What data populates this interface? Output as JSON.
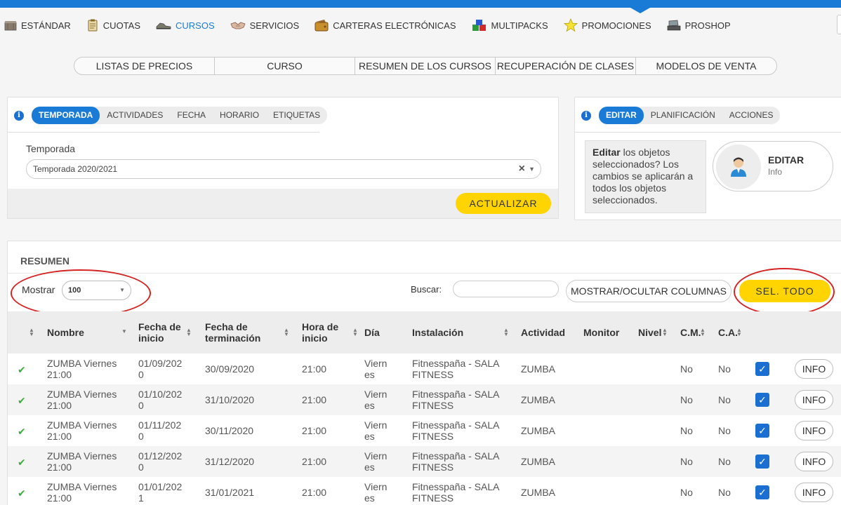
{
  "nav": {
    "items": [
      {
        "label": "ESTÁNDAR",
        "icon": "box-icon",
        "active": false
      },
      {
        "label": "CUOTAS",
        "icon": "clipboard-icon",
        "active": false
      },
      {
        "label": "CURSOS",
        "icon": "shoe-icon",
        "active": true
      },
      {
        "label": "SERVICIOS",
        "icon": "handshake-icon",
        "active": false
      },
      {
        "label": "CARTERAS ELECTRÓNICAS",
        "icon": "wallet-icon",
        "active": false
      },
      {
        "label": "MULTIPACKS",
        "icon": "cubes-icon",
        "active": false
      },
      {
        "label": "PROMOCIONES",
        "icon": "star-icon",
        "active": false
      },
      {
        "label": "PROSHOP",
        "icon": "register-icon",
        "active": false
      }
    ]
  },
  "subtabs": [
    "LISTAS DE PRECIOS",
    "CURSO",
    "RESUMEN DE LOS CURSOS",
    "RECUPERACIÓN DE CLASES",
    "MODELOS DE VENTA"
  ],
  "filter": {
    "tabs": [
      "TEMPORADA",
      "ACTIVIDADES",
      "FECHA",
      "HORARIO",
      "ETIQUETAS"
    ],
    "field_label": "Temporada",
    "selected": "Temporada 2020/2021",
    "update_label": "ACTUALIZAR"
  },
  "actions": {
    "tabs": [
      "EDITAR",
      "PLANIFICACIÓN",
      "ACCIONES"
    ],
    "desc_bold": "Editar",
    "desc_rest": " los objetos seleccionados? Los cambios se aplicarán a todos los objetos seleccionados.",
    "card_title": "EDITAR",
    "card_sub": "Info"
  },
  "summary": {
    "title": "RESUMEN",
    "show_label": "Mostrar",
    "show_value": "100",
    "search_label": "Buscar:",
    "columns_button": "MOSTRAR/OCULTAR COLUMNAS",
    "select_all": "SEL. TODO",
    "headers": [
      "Nombre",
      "Fecha de inicio",
      "Fecha de terminación",
      "Hora de inicio",
      "Día",
      "Instalación",
      "Actividad",
      "Monitor",
      "Nivel",
      "C.M.",
      "C.A."
    ],
    "rows": [
      {
        "nombre": "ZUMBA Viernes 21:00",
        "inicio": "01/09/2020",
        "fin": "30/09/2020",
        "hora": "21:00",
        "dia": "Viernes",
        "inst": "Fitnesspaña - SALA FITNESS",
        "act": "ZUMBA",
        "cm": "No",
        "ca": "No",
        "info": "INFO"
      },
      {
        "nombre": "ZUMBA Viernes 21:00",
        "inicio": "01/10/2020",
        "fin": "31/10/2020",
        "hora": "21:00",
        "dia": "Viernes",
        "inst": "Fitnesspaña - SALA FITNESS",
        "act": "ZUMBA",
        "cm": "No",
        "ca": "No",
        "info": "INFO"
      },
      {
        "nombre": "ZUMBA Viernes 21:00",
        "inicio": "01/11/2020",
        "fin": "30/11/2020",
        "hora": "21:00",
        "dia": "Viernes",
        "inst": "Fitnesspaña - SALA FITNESS",
        "act": "ZUMBA",
        "cm": "No",
        "ca": "No",
        "info": "INFO"
      },
      {
        "nombre": "ZUMBA Viernes 21:00",
        "inicio": "01/12/2020",
        "fin": "31/12/2020",
        "hora": "21:00",
        "dia": "Viernes",
        "inst": "Fitnesspaña - SALA FITNESS",
        "act": "ZUMBA",
        "cm": "No",
        "ca": "No",
        "info": "INFO"
      },
      {
        "nombre": "ZUMBA Viernes 21:00",
        "inicio": "01/01/2021",
        "fin": "31/01/2021",
        "hora": "21:00",
        "dia": "Viernes",
        "inst": "Fitnesspaña - SALA FITNESS",
        "act": "ZUMBA",
        "cm": "No",
        "ca": "No",
        "info": "INFO"
      }
    ]
  },
  "colors": {
    "accent": "#1a7bd6",
    "yellow": "#ffd400",
    "annotation": "#d62424",
    "check": "#3aad3a"
  }
}
